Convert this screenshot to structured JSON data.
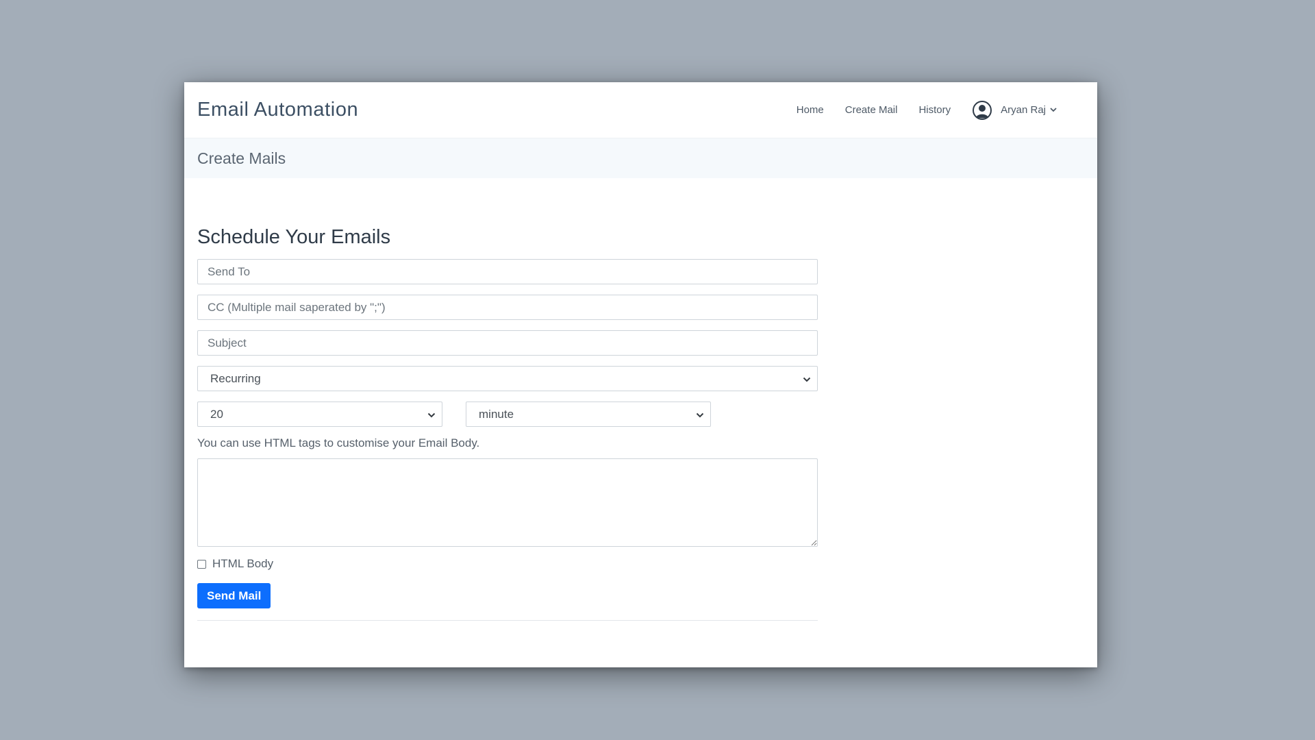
{
  "header": {
    "brand": "Email Automation",
    "nav": {
      "home": "Home",
      "create_mail": "Create Mail",
      "history": "History"
    },
    "user": {
      "name": "Aryan Raj",
      "icon": "user-circle-icon"
    }
  },
  "subheader": {
    "title": "Create Mails"
  },
  "form": {
    "heading": "Schedule Your Emails",
    "send_to_placeholder": "Send To",
    "cc_placeholder": "CC (Multiple mail saperated by \";\")",
    "subject_placeholder": "Subject",
    "schedule_type": "Recurring",
    "interval_value": "20",
    "interval_unit": "minute",
    "hint": "You can use HTML tags to customise your Email Body.",
    "body_value": "",
    "html_body_label": "HTML Body",
    "html_body_checked": false,
    "submit_label": "Send Mail"
  },
  "colors": {
    "background": "#a3adb8",
    "primary": "#0d6efd",
    "subheader_bg": "#f5f9fc",
    "brand_text": "#3c4f63"
  }
}
